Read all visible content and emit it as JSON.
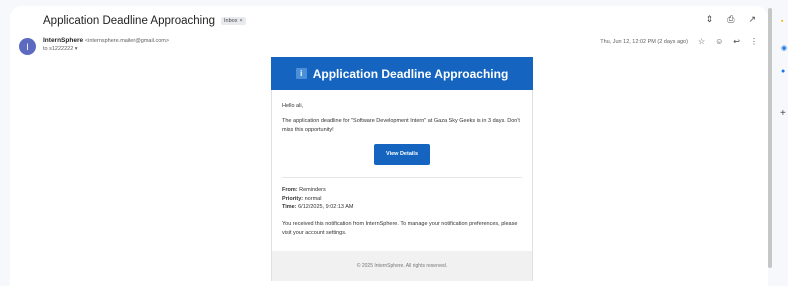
{
  "email": {
    "subject": "Application Deadline Approaching",
    "inbox_chip": "Inbox",
    "chip_close": "×",
    "sender_initial": "I",
    "sender_name": "InternSphere",
    "sender_email": "<internsphere.mailer@gmail.com>",
    "to_line": "to s1222222 ▾",
    "timestamp": "Thu, Jun 12, 12:02 PM (2 days ago)"
  },
  "content": {
    "banner_title": "Application Deadline Approaching",
    "greeting": "Hello ali,",
    "message": "The application deadline for \"Software Development Intern\" at Gaza Sky Geeks is in 3 days. Don't miss this opportunity!",
    "button_label": "View Details",
    "from_label": "From:",
    "from_value": "Reminders",
    "priority_label": "Priority:",
    "priority_value": "normal",
    "time_label": "Time:",
    "time_value": "6/12/2025, 9:02:13 AM",
    "notice": "You received this notification from InternSphere. To manage your notification preferences, please visit your account settings.",
    "footer": "© 2025 InternSphere. All rights reserved."
  },
  "icons": {
    "expand": "⇕",
    "print": "⎙",
    "open_new": "↗",
    "star": "☆",
    "emoji": "☺",
    "reply": "↩",
    "more": "⋮",
    "info": "i",
    "side_keep": "▪",
    "side_tasks": "◉",
    "side_contacts": "●",
    "side_add": "+"
  }
}
